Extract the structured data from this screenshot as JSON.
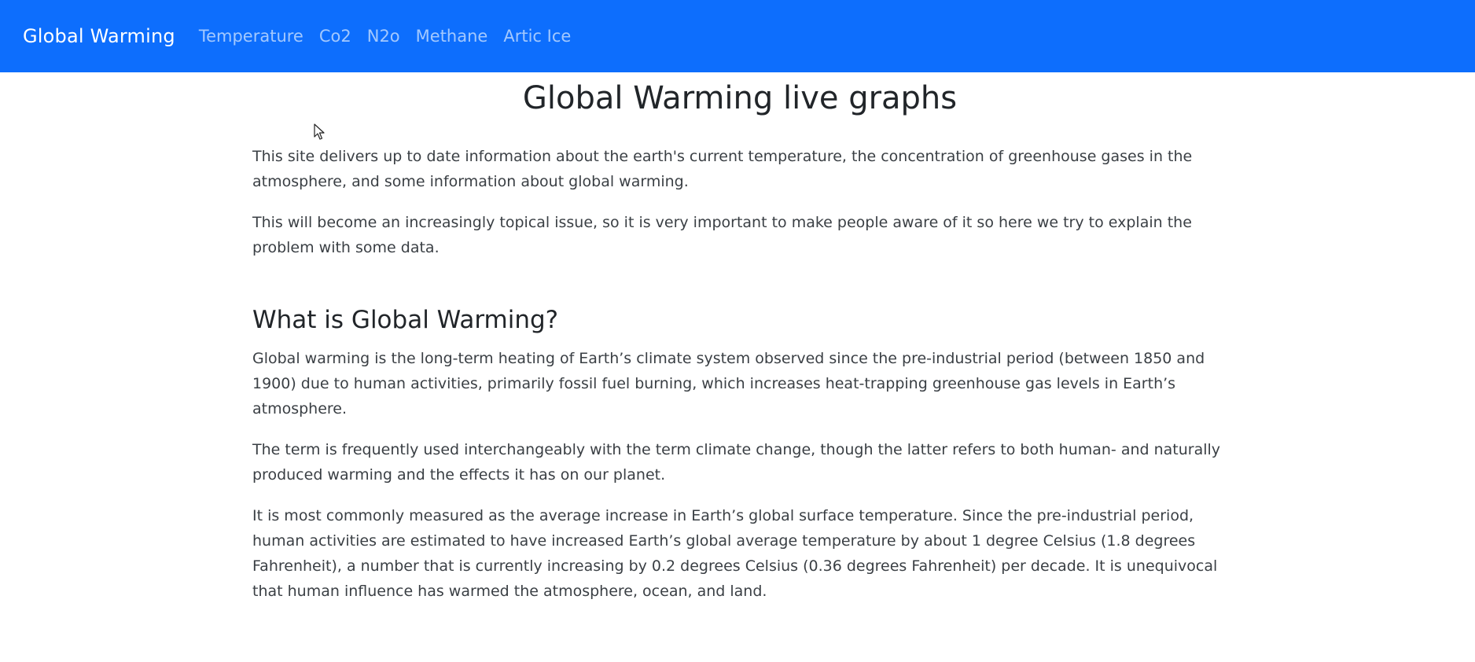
{
  "navbar": {
    "brand": "Global Warming",
    "links": [
      {
        "label": "Temperature"
      },
      {
        "label": "Co2"
      },
      {
        "label": "N2o"
      },
      {
        "label": "Methane"
      },
      {
        "label": "Artic Ice"
      }
    ]
  },
  "main": {
    "title": "Global Warming live graphs",
    "intro": [
      "This site delivers up to date information about the earth's current temperature, the concentration of greenhouse gases in the atmosphere, and some information about global warming.",
      "This will become an increasingly topical issue, so it is very important to make people aware of it so here we try to explain the problem with some data."
    ],
    "section": {
      "heading": "What is Global Warming?",
      "paragraphs": [
        "Global warming is the long-term heating of Earth’s climate system observed since the pre-industrial period (between 1850 and 1900) due to human activities, primarily fossil fuel burning, which increases heat-trapping greenhouse gas levels in Earth’s atmosphere.",
        "The term is frequently used interchangeably with the term climate change, though the latter refers to both human- and naturally produced warming and the effects it has on our planet.",
        "It is most commonly measured as the average increase in Earth’s global surface temperature. Since the pre-industrial period, human activities are estimated to have increased Earth’s global average temperature by about 1 degree Celsius (1.8 degrees Fahrenheit), a number that is currently increasing by 0.2 degrees Celsius (0.36 degrees Fahrenheit) per decade. It is unequivocal that human influence has warmed the atmosphere, ocean, and land."
      ]
    }
  },
  "colors": {
    "navbar_bg": "#0d6efd",
    "brand_text": "#ffffff",
    "nav_link_text": "rgba(255,255,255,0.62)",
    "body_text": "#3a3f44",
    "heading_text": "#212529"
  },
  "icons": {
    "cursor": "mouse-pointer-icon"
  }
}
